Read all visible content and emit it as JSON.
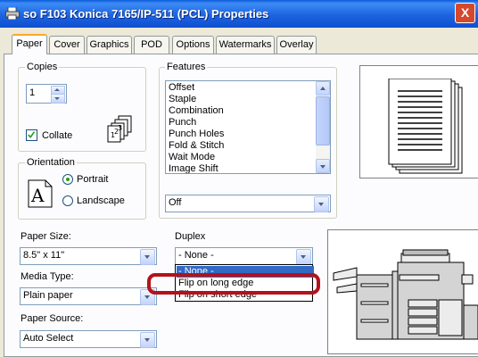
{
  "window": {
    "title": "so F103 Konica 7165/IP-511 (PCL) Properties",
    "close_label": "X"
  },
  "tabs": [
    {
      "label": "Paper",
      "active": true
    },
    {
      "label": "Cover"
    },
    {
      "label": "Graphics"
    },
    {
      "label": "POD"
    },
    {
      "label": "Options"
    },
    {
      "label": "Watermarks"
    },
    {
      "label": "Overlay"
    }
  ],
  "copies": {
    "group_label": "Copies",
    "value": "1",
    "collate_label": "Collate",
    "collate_checked": true
  },
  "features": {
    "group_label": "Features",
    "items": [
      "Offset",
      "Staple",
      "Combination",
      "Punch",
      "Punch Holes",
      "Fold & Stitch",
      "Wait Mode",
      "Image Shift"
    ],
    "setting_value": "Off"
  },
  "orientation": {
    "group_label": "Orientation",
    "portrait_label": "Portrait",
    "landscape_label": "Landscape",
    "selected": "Portrait"
  },
  "paper_size": {
    "label": "Paper Size:",
    "value": "8.5\" x 11\""
  },
  "media_type": {
    "label": "Media Type:",
    "value": "Plain paper"
  },
  "paper_source": {
    "label": "Paper Source:",
    "value": "Auto Select"
  },
  "duplex": {
    "label": "Duplex",
    "value": "- None -",
    "options": [
      "- None -",
      "Flip on long edge",
      "Flip on short edge"
    ],
    "highlighted_option": "- None -",
    "circled_option": "Flip on long edge"
  },
  "icons": {
    "printer_icon": "printer-icon",
    "collate_icon": "collate-pages-icon",
    "portrait_icon": "portrait-A-icon",
    "copier_illustration": "copier-machine-icon"
  },
  "colors": {
    "title_bar": "#0f4fd0",
    "tab_accent": "#f9a72a",
    "selection": "#316ac5",
    "annotation": "#b4121b"
  }
}
